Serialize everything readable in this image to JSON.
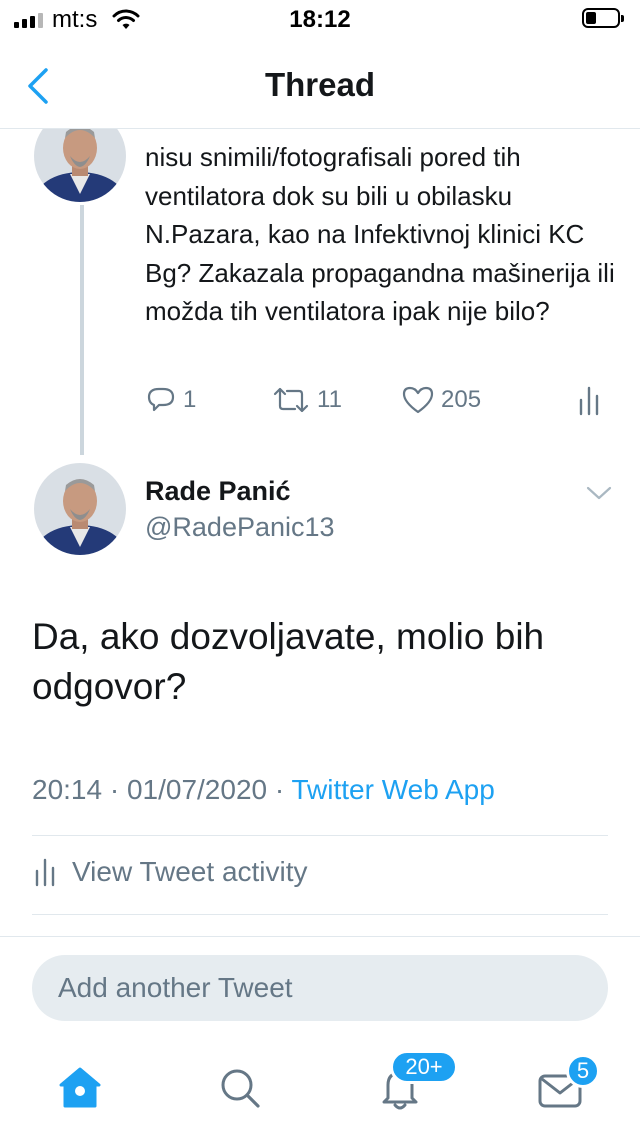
{
  "status_bar": {
    "carrier": "mt:s",
    "time": "18:12"
  },
  "nav": {
    "title": "Thread"
  },
  "parent_tweet": {
    "text": "nisu snimili/fotografisali pored tih ventilatora dok su bili u obilasku N.Pazara, kao na Infektivnoj klinici KC Bg? Zakazala propagandna mašinerija ili možda tih ventilatora ipak nije bilo?",
    "replies": "1",
    "retweets": "11",
    "likes": "205"
  },
  "tweet": {
    "name": "Rade Panić",
    "handle": "@RadePanic13",
    "text": "Da, ako dozvoljavate, molio bih odgovor?",
    "time": "20:14 · 01/07/2020 · ",
    "source": "Twitter Web App"
  },
  "activity_label": "View Tweet activity",
  "compose_placeholder": "Add another Tweet",
  "tabbar": {
    "notifications_badge": "20+",
    "messages_badge": "5"
  },
  "colors": {
    "accent": "#1da1f2",
    "secondary_text": "#657786",
    "divider": "#e1e8ed"
  }
}
